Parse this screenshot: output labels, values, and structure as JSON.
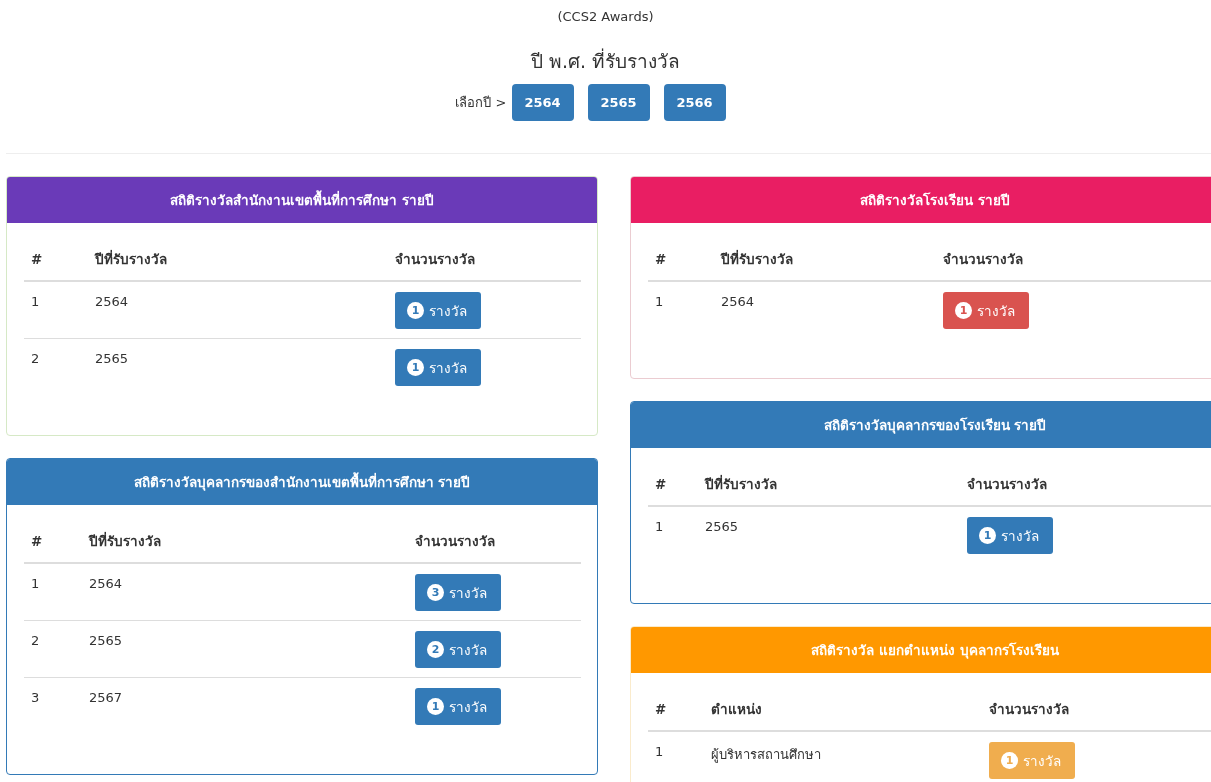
{
  "header": {
    "subtitle": "(CCS2 Awards)",
    "title": "ปี พ.ศ. ที่รับรางวัล",
    "year_prompt": "เลือกปี >",
    "year_buttons": [
      "2564",
      "2565",
      "2566"
    ]
  },
  "left_column": [
    {
      "title": "สถิติรางวัลสำนักงานเขตพื้นที่การศึกษา รายปี",
      "color": "#6a3ab8",
      "kind": "success",
      "columns": [
        "#",
        "ปีที่รับรางวัล",
        "จำนวนรางวัล"
      ],
      "rows": [
        {
          "number": "1",
          "value": "2564",
          "count": "1",
          "label": "รางวัล",
          "color": "#337ab7"
        },
        {
          "number": "2",
          "value": "2565",
          "count": "1",
          "label": "รางวัล",
          "color": "#337ab7"
        }
      ]
    },
    {
      "title": "สถิติรางวัลบุคลากรของสำนักงานเขตพื้นที่การศึกษา รายปี",
      "color": "#337ab7",
      "kind": "primary",
      "columns": [
        "#",
        "ปีที่รับรางวัล",
        "จำนวนรางวัล"
      ],
      "rows": [
        {
          "number": "1",
          "value": "2564",
          "count": "3",
          "label": "รางวัล",
          "color": "#337ab7"
        },
        {
          "number": "2",
          "value": "2565",
          "count": "2",
          "label": "รางวัล",
          "color": "#337ab7"
        },
        {
          "number": "3",
          "value": "2567",
          "count": "1",
          "label": "รางวัล",
          "color": "#337ab7"
        }
      ]
    }
  ],
  "right_column": [
    {
      "title": "สถิติรางวัลโรงเรียน รายปี",
      "color": "#e91e63",
      "kind": "danger",
      "columns": [
        "#",
        "ปีที่รับรางวัล",
        "จำนวนรางวัล"
      ],
      "rows": [
        {
          "number": "1",
          "value": "2564",
          "count": "1",
          "label": "รางวัล",
          "color": "#d9534f"
        }
      ]
    },
    {
      "title": "สถิติรางวัลบุคลากรของโรงเรียน รายปี",
      "color": "#337ab7",
      "kind": "primary",
      "columns": [
        "#",
        "ปีที่รับรางวัล",
        "จำนวนรางวัล"
      ],
      "rows": [
        {
          "number": "1",
          "value": "2565",
          "count": "1",
          "label": "รางวัล",
          "color": "#337ab7"
        }
      ]
    },
    {
      "title": "สถิติรางวัล แยกตำแหน่ง บุคลากรโรงเรียน",
      "color": "#ff9800",
      "kind": "warning",
      "columns": [
        "#",
        "ตำแหน่ง",
        "จำนวนรางวัล"
      ],
      "rows": [
        {
          "number": "1",
          "value": "ผู้บริหารสถานศึกษา",
          "count": "1",
          "label": "รางวัล",
          "color": "#f0ad4e"
        }
      ]
    }
  ]
}
